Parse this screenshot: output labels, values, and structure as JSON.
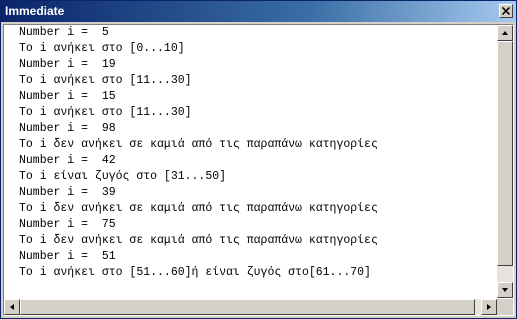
{
  "window": {
    "title": "Immediate",
    "close_icon": "close-icon"
  },
  "output_lines": [
    "Number i =  5",
    "To i ανήκει στο [0...10]",
    "Number i =  19",
    "To i ανήκει στο [11...30]",
    "Number i =  15",
    "To i ανήκει στο [11...30]",
    "Number i =  98",
    "To i δεν ανήκει σε καμιά από τις παραπάνω κατηγορίες",
    "Number i =  42",
    "To i είναι ζυγός στο [31...50]",
    "Number i =  39",
    "To i δεν ανήκει σε καμιά από τις παραπάνω κατηγορίες",
    "Number i =  75",
    "To i δεν ανήκει σε καμιά από τις παραπάνω κατηγορίες",
    "Number i =  51",
    "To i ανήκει στο [51...60]ή είναι ζυγός στο[61...70]"
  ],
  "scrollbars": {
    "vertical_position": 0,
    "horizontal_position": 0
  }
}
